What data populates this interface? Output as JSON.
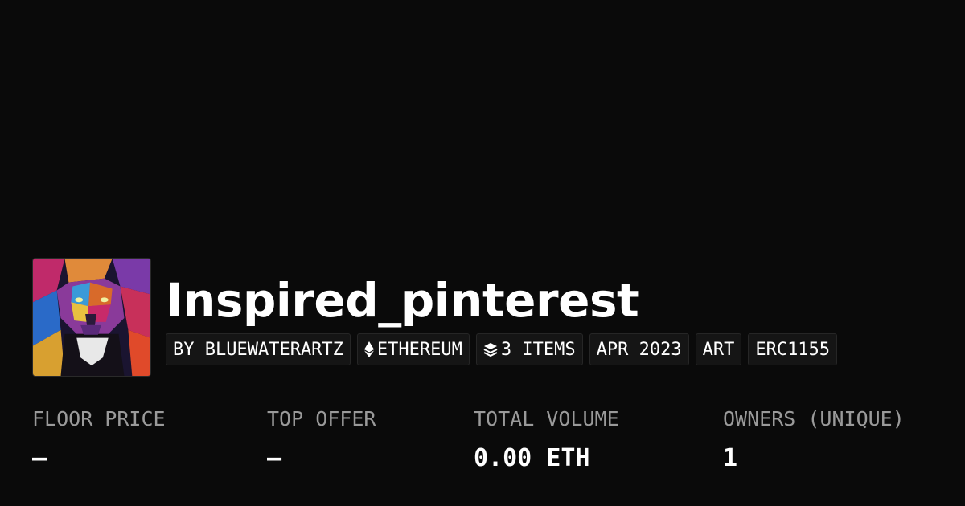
{
  "collection": {
    "name": "Inspired_pinterest",
    "avatar_icon": "lion-painting-avatar"
  },
  "tags": {
    "creator": "BY BLUEWATERARTZ",
    "chain": "ETHEREUM",
    "chain_icon": "ethereum-icon",
    "items": "3 ITEMS",
    "items_icon": "layers-icon",
    "date": "APR 2023",
    "category": "ART",
    "standard": "ERC1155"
  },
  "stats": {
    "floor_price": {
      "label": "FLOOR PRICE",
      "value": "–"
    },
    "top_offer": {
      "label": "TOP OFFER",
      "value": "–"
    },
    "total_volume": {
      "label": "TOTAL VOLUME",
      "value": "0.00 ETH"
    },
    "owners": {
      "label": "OWNERS (UNIQUE)",
      "value": "1"
    }
  },
  "colors": {
    "background": "#0a0a0a",
    "tag_background": "#151515",
    "label_gray": "#9a9a9a",
    "text": "#ffffff"
  }
}
